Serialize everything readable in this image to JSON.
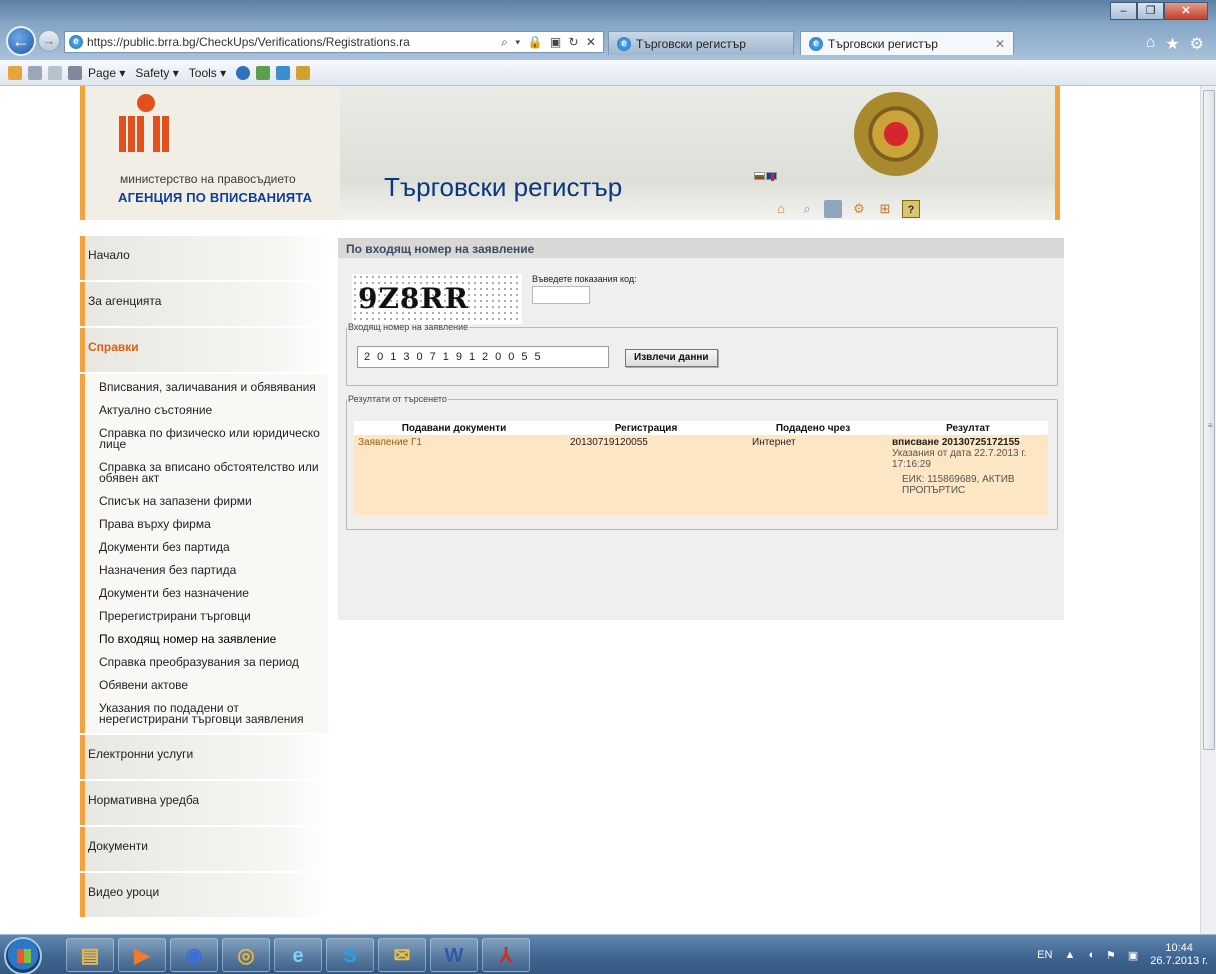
{
  "browser": {
    "address_url": "https://public.brra.bg/CheckUps/Verifications/Registrations.ra",
    "address_tools": "⌕ ▾ 🔒 ▣ ↻ ✕",
    "tabs": [
      {
        "label": "Търговски регистър",
        "active": false
      },
      {
        "label": "Търговски регистър",
        "active": true,
        "close": "✕"
      }
    ],
    "command_bar": {
      "items": [
        "Page ▾",
        "Safety ▾",
        "Tools ▾"
      ]
    },
    "window_buttons": [
      "–",
      "❐",
      "✕"
    ],
    "right_icons": [
      "⌂",
      "★",
      "⚙"
    ]
  },
  "header": {
    "ministry": "министерство на правосъдието",
    "agency": "АГЕНЦИЯ ПО ВПИСВАНИЯТА",
    "site_title": "Търговски регистър"
  },
  "nav": {
    "top_items": [
      "Начало",
      "За агенцията"
    ],
    "active_item": "Справки",
    "sub_items": [
      "Вписвания, заличавания и обявявания",
      "Актуално състояние",
      "Справка по физическо или юридическо лице",
      "Справка за вписано обстоятелство или обявен акт",
      "Списък на запазени фирми",
      "Права върху фирма",
      "Документи без партида",
      "Назначения без партида",
      "Документи без назначение",
      "Пререгистрирани търговци",
      "По входящ номер на заявление",
      "Справка преобразувания за период",
      "Обявени актове",
      "Указания по подадени от нерегистрирани търговци заявления"
    ],
    "bottom_items": [
      "Електронни услуги",
      "Нормативна уредба",
      "Документи",
      "Видео уроци"
    ]
  },
  "main": {
    "heading": "По входящ номер на заявление",
    "captcha_text": "9Z8RR",
    "captcha_label": "Въведете показания код:",
    "captcha_value": "",
    "reg_legend": "Входящ номер на заявление",
    "reg_digits": "20130719120055",
    "fetch_button": "Извлечи данни",
    "results_legend": "Резултати от търсенето",
    "columns": [
      "Подавани документи",
      "Регистрация",
      "Подадено чрез",
      "Резултат"
    ],
    "row": {
      "document": "Заявление Г1",
      "registration": "20130719120055",
      "submitted_via": "Интернет",
      "result_main": "вписване 20130725172155",
      "result_note": "Указания от дата 22.7.2013 г. 17:16:29",
      "result_eik": "ЕИК: 115869689, АКТИВ ПРОПЪРТИС"
    }
  },
  "taskbar": {
    "language": "EN",
    "time": "10:44",
    "date": "26.7.2013 г."
  },
  "colors": {
    "accent_orange": "#f6a13a",
    "agency_blue": "#0b3da0",
    "active_nav": "#e35d0d",
    "result_row": "#fde6c3"
  }
}
